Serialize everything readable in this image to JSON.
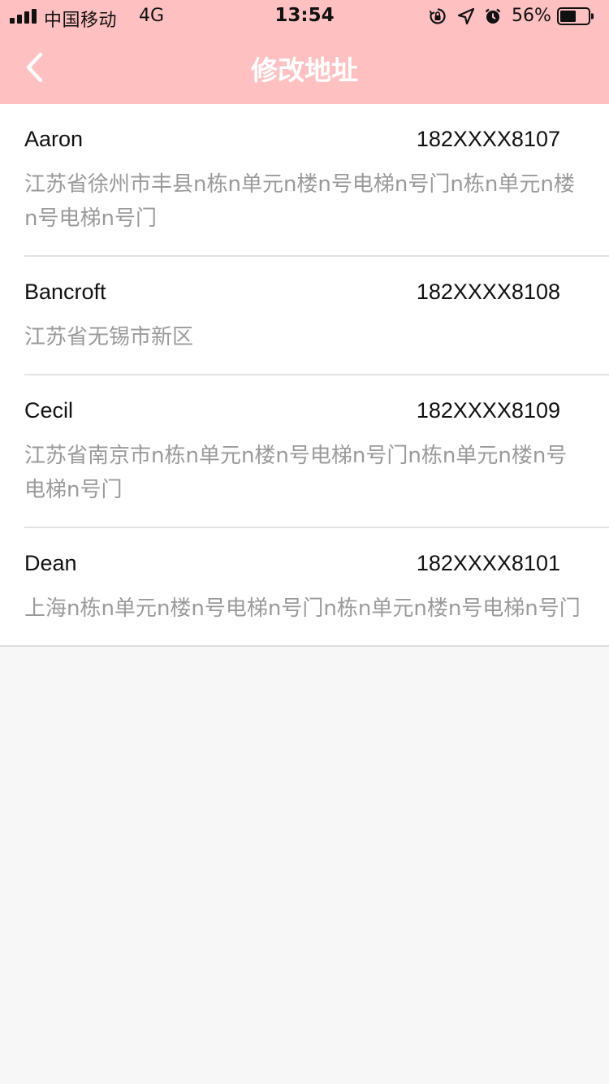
{
  "status_bar": {
    "carrier": "中国移动",
    "network": "4G",
    "time": "13:54",
    "battery_percent": "56%",
    "icons": [
      "signal-icon",
      "rotation-lock-icon",
      "location-icon",
      "alarm-icon",
      "battery-icon"
    ]
  },
  "nav": {
    "title": "修改地址",
    "back_icon": "back-chevron-icon",
    "background": "#ffc0c1"
  },
  "addresses": [
    {
      "name": "Aaron",
      "phone": "182XXXX8107",
      "address": "江苏省徐州市丰县n栋n单元n楼n号电梯n号门n栋n单元n楼n号电梯n号门"
    },
    {
      "name": "Bancroft",
      "phone": "182XXXX8108",
      "address": "江苏省无锡市新区"
    },
    {
      "name": "Cecil",
      "phone": "182XXXX8109",
      "address": "江苏省南京市n栋n单元n楼n号电梯n号门n栋n单元n楼n号电梯n号门"
    },
    {
      "name": "Dean",
      "phone": "182XXXX8101",
      "address": "上海n栋n单元n楼n号电梯n号门n栋n单元n楼n号电梯n号门"
    }
  ]
}
